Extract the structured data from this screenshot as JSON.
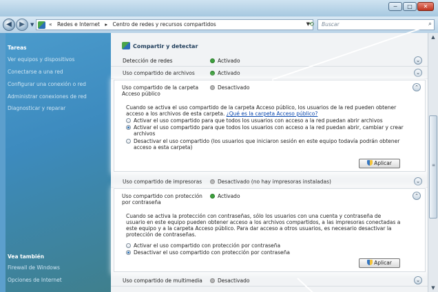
{
  "window": {
    "minimize": "─",
    "maximize": "□",
    "close": "✕"
  },
  "nav": {
    "overflow": "«",
    "breadcrumbs": [
      "Redes e Internet",
      "▸",
      "Centro de redes y recursos compartidos"
    ],
    "search_placeholder": "Buscar"
  },
  "sidebar": {
    "tasks_header": "Tareas",
    "tasks": [
      "Ver equipos y dispositivos",
      "Conectarse a una red",
      "Configurar una conexión o red",
      "Administrar conexiones de red",
      "Diagnosticar y reparar"
    ],
    "see_also_header": "Vea también",
    "see_also": [
      "Firewall de Windows",
      "Opciones de Internet"
    ]
  },
  "main": {
    "section_title": "Compartir y detectar",
    "rows": [
      {
        "label": "Detección de redes",
        "status": "Activado",
        "state": "on"
      },
      {
        "label": "Uso compartido de archivos",
        "status": "Activado",
        "state": "on"
      }
    ],
    "public_folder": {
      "title_line1": "Uso compartido de la carpeta",
      "title_line2": "Acceso público",
      "status": "Desactivado",
      "desc": "Cuando se activa el uso compartido de la carpeta Acceso público, los usuarios de la red pueden obtener acceso a los archivos de esta carpeta.",
      "link": "¿Qué es la carpeta Acceso público?",
      "options": [
        "Activar el uso compartido para que todos los usuarios con acceso a la red puedan abrir archivos",
        "Activar el uso compartido para que todos los usuarios con acceso a la red puedan abrir, cambiar y crear archivos",
        "Desactivar el uso compartido (los usuarios que iniciaron sesión en este equipo todavía podrán obtener acceso a esta carpeta)"
      ],
      "selected": 1,
      "apply": "Aplicar"
    },
    "printers": {
      "label": "Uso compartido de impresoras",
      "status": "Desactivado (no hay impresoras instaladas)",
      "state": "off"
    },
    "password": {
      "title_line1": "Uso compartido con protección",
      "title_line2": "por contraseña",
      "status": "Activado",
      "desc": "Cuando se activa la protección con contraseñas, sólo los usuarios con una cuenta y contraseña de usuario en este equipo pueden obtener acceso a los archivos compartidos, a las impresoras conectadas a este equipo y a la carpeta Acceso público. Para dar acceso a otros usuarios, es necesario desactivar la protección de contraseñas.",
      "options": [
        "Activar el uso compartido con protección por contraseña",
        "Desactivar el uso compartido con protección por contraseña"
      ],
      "selected": 1,
      "apply": "Aplicar"
    },
    "multimedia": {
      "label": "Uso compartido de multimedia",
      "status": "Desactivado",
      "state": "off"
    }
  },
  "colors": {
    "on": "#3da13d",
    "off": "#b5b5b5",
    "link": "#0645ad"
  }
}
